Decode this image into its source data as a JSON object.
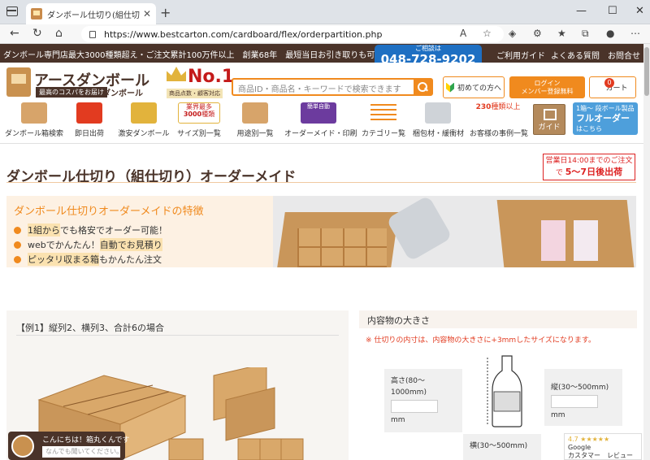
{
  "browser": {
    "tab_title": "ダンボール仕切り(組仕切り)オーダーメ",
    "url": "https://www.bestcarton.com/cardboard/flex/orderpartition.php"
  },
  "site": {
    "topstrip": "ダンボール専門店最大3000種類超え・ご注文累計100万件以上　創業68年　最短当日お引き取りも可能　幸せのダンボー",
    "phone_label": "ご相談は",
    "phone_number": "048-728-9202",
    "links": {
      "guide": "ご利用ガイド",
      "faq": "よくある質問",
      "contact": "お問合せ"
    },
    "logo_main": "アースダンボール",
    "logo_sub": "最高のコスパをお届け",
    "logo_sub2": "ダンボール",
    "no1_text": "No.1",
    "no1_sub": "商品点数・顧客対応",
    "search_placeholder": "商品ID・商品名・キーワードで検索できます",
    "first_time": "初めての方へ",
    "login": "ログイン",
    "register": "メンバー登録無料",
    "cart": "カート",
    "cart_count": "0"
  },
  "categories": [
    {
      "label": "ダンボール箱検索",
      "color": "#d7a46a"
    },
    {
      "label": "即日出荷",
      "color": "#e23b20"
    },
    {
      "label": "激安ダンボール",
      "color": "#e2b33c"
    },
    {
      "label": "サイズ別一覧",
      "color": "#d7a46a"
    },
    {
      "label": "用途別一覧",
      "color": "#d7a46a"
    },
    {
      "label": "オーダーメイド・印刷",
      "color": "#6c3b9e"
    },
    {
      "label": "カテゴリー覧",
      "color": "#f08a1e"
    },
    {
      "label": "梱包材・緩衝材",
      "color": "#cfd3d8"
    },
    {
      "label": "お客様の事例一覧",
      "color": "#d7a46a"
    }
  ],
  "cat_badges": {
    "size_top": "業界最多",
    "size_num": "3000",
    "size_unit": "種類",
    "case_num": "230",
    "case_unit": "種類以上",
    "order_tag": "簡単自動"
  },
  "guide": "ガイド",
  "one_box": {
    "l1": "1箱〜",
    "l2": "段ボール製品",
    "l3": "フルオーダー",
    "l4": "はこちら"
  },
  "page": {
    "title": "ダンボール仕切り（組仕切り）オーダーメイド",
    "note_line1": "営業日14:00までのご注文",
    "note_pre": "で",
    "note_line2": "5〜7日後出荷",
    "feature_title": "ダンボール仕切りオーダーメイドの特徴",
    "feature_items": [
      {
        "hl": "1組から",
        "rest": "でも格安でオーダー可能！"
      },
      {
        "pre": "webでかんたん！",
        "hl": "自動でお見積り"
      },
      {
        "hl": "ピッタリ収まる箱",
        "rest": "もかんたん注文"
      }
    ],
    "example": "【例1】縦列2、横列3、合計6の場合",
    "contents_title": "内容物の大きさ",
    "warning": "※ 仕切りの内寸は、内容物の大きさに+3mmしたサイズになります。",
    "height": {
      "label": "高さ(80～1000mm)",
      "unit": "mm"
    },
    "depth": {
      "label": "縦(30〜500mm)",
      "unit": "mm"
    },
    "width": {
      "label": "横(30〜500mm)"
    }
  },
  "review": {
    "rating": "4.7 ★★★★★",
    "source": "Google",
    "label": "カスタマー　レビュー"
  },
  "chat": {
    "greeting": "こんにちは！箱丸くんです",
    "placeholder": "なんでも聞いてください。"
  }
}
